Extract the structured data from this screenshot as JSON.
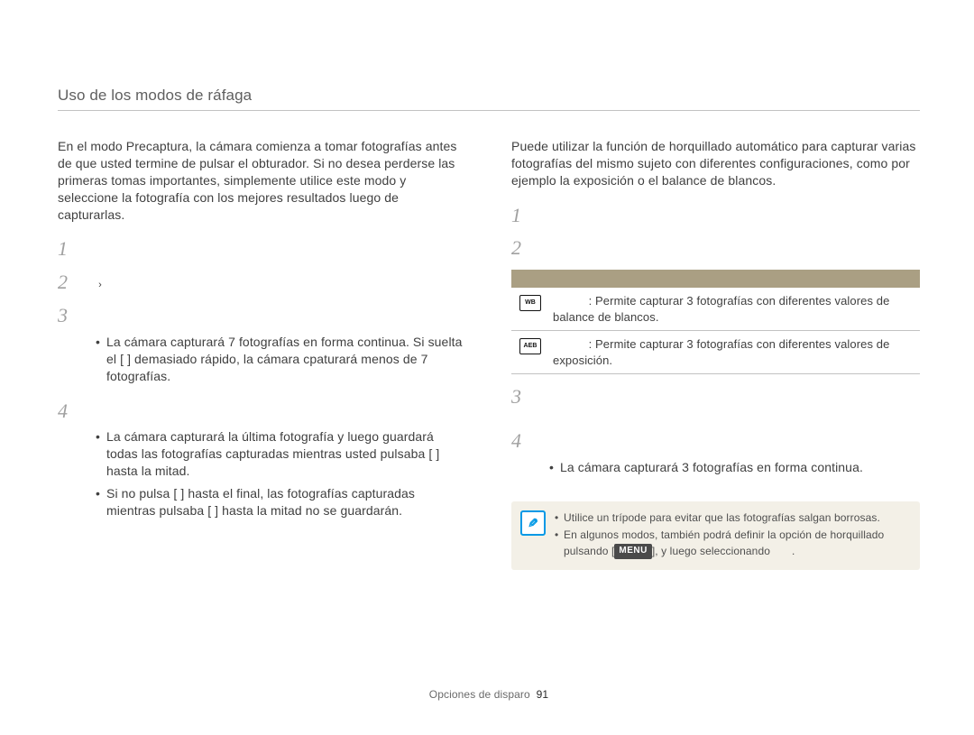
{
  "header": "Uso de los modos de ráfaga",
  "left": {
    "intro": "En el modo Precaptura, la cámara comienza a tomar fotografías antes de que usted termine de pulsar el obturador. Si no desea perderse las primeras tomas importantes, simplemente utilice este modo y seleccione la fotografía con los mejores resultados luego de capturarlas.",
    "steps": [
      "1",
      "2",
      "3",
      "4"
    ],
    "chev": "›",
    "bullets3": [
      "La cámara capturará 7 fotografías en forma continua. Si suelta el [          ] demasiado rápido, la cámara cpaturará menos de 7 fotografías."
    ],
    "bullets4": [
      "La cámara capturará la última fotografía y luego guardará todas las fotografías capturadas mientras usted pulsaba [          ] hasta la mitad.",
      "Si no pulsa [          ] hasta el final, las fotografías capturadas mientras pulsaba [          ] hasta la mitad no se guardarán."
    ]
  },
  "right": {
    "intro": "Puede utilizar la función de horquillado automático para capturar varias fotografías del mismo sujeto con diferentes configuraciones, como por ejemplo la exposición o el balance de blancos.",
    "steps": [
      "1",
      "2",
      "3",
      "4"
    ],
    "table": [
      {
        "icon": "WB",
        "text": ": Permite capturar 3 fotografías con diferentes valores de balance de blancos."
      },
      {
        "icon": "AEB",
        "text": ": Permite capturar 3 fotografías con diferentes valores de exposición."
      }
    ],
    "bullet4": "La cámara capturará 3 fotografías en forma continua.",
    "note": [
      "Utilice un trípode para evitar que las fotografías salgan borrosas.",
      "En algunos modos, también podrá definir la opción de horquillado pulsando [MENU], y luego seleccionando            ."
    ],
    "menuLabel": "MENU"
  },
  "footer": {
    "section": "Opciones de disparo",
    "page": "91"
  }
}
